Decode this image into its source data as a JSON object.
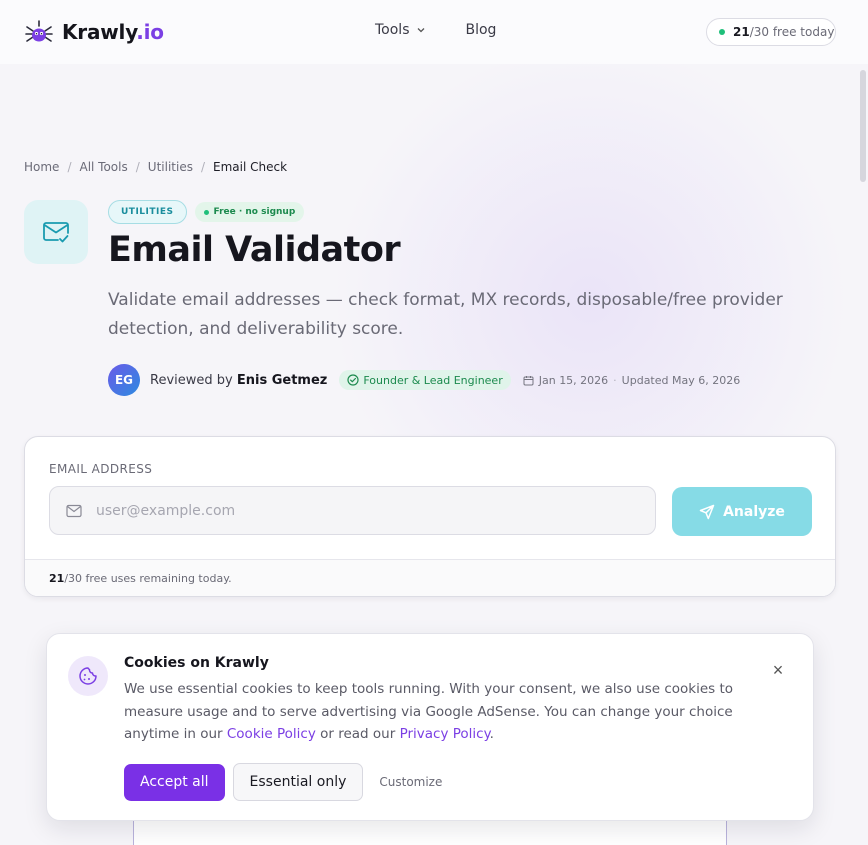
{
  "brand": {
    "name": "Krawly",
    "tld": ".io",
    "accent": "#7b3fe4"
  },
  "nav": [
    {
      "label": "Tools",
      "has_dropdown": true
    },
    {
      "label": "Blog",
      "has_dropdown": false
    }
  ],
  "quota_pill": {
    "used": "21",
    "rest": "/30 free today"
  },
  "breadcrumb": [
    "Home",
    "All Tools",
    "Utilities",
    "Email Check"
  ],
  "hero": {
    "category_tag": "UTILITIES",
    "free_tag": "Free · no signup",
    "title": "Email Validator",
    "subtitle": "Validate email addresses — check format, MX records, disposable/free provider detection, and deliverability score."
  },
  "reviewer": {
    "initials": "EG",
    "prefix": "Reviewed by",
    "name": "Enis Getmez",
    "role": "Founder & Lead Engineer",
    "date": "Jan 15, 2026",
    "sep": "·",
    "updated": "Updated May 6, 2026"
  },
  "form": {
    "label": "EMAIL ADDRESS",
    "placeholder": "user@example.com",
    "value": "",
    "button_label": "Analyze",
    "footer_count": "21",
    "footer_rest": "/30 free uses remaining today."
  },
  "cookie": {
    "title": "Cookies on Krawly",
    "text_before": "We use essential cookies to keep tools running. With your consent, we also use cookies to measure usage and to serve advertising via Google AdSense. You can change your choice anytime in our ",
    "cookie_policy_link": "Cookie Policy",
    "text_mid": " or read our ",
    "privacy_policy_link": "Privacy Policy",
    "text_end": ".",
    "accept_label": "Accept all",
    "essential_label": "Essential only",
    "customize_label": "Customize",
    "close_icon": "×"
  },
  "colors": {
    "primary_button": "#7a30e6",
    "analyze_button": "#86dbe6",
    "success": "#1fbf7a",
    "icon_tint": "#1a9bb0"
  },
  "icons": {
    "logo": "spider-icon",
    "tool": "mail-check-icon",
    "role_badge": "check-circle-icon",
    "date": "calendar-icon",
    "input": "mail-icon",
    "analyze": "send-icon",
    "cookie": "cookie-icon"
  }
}
